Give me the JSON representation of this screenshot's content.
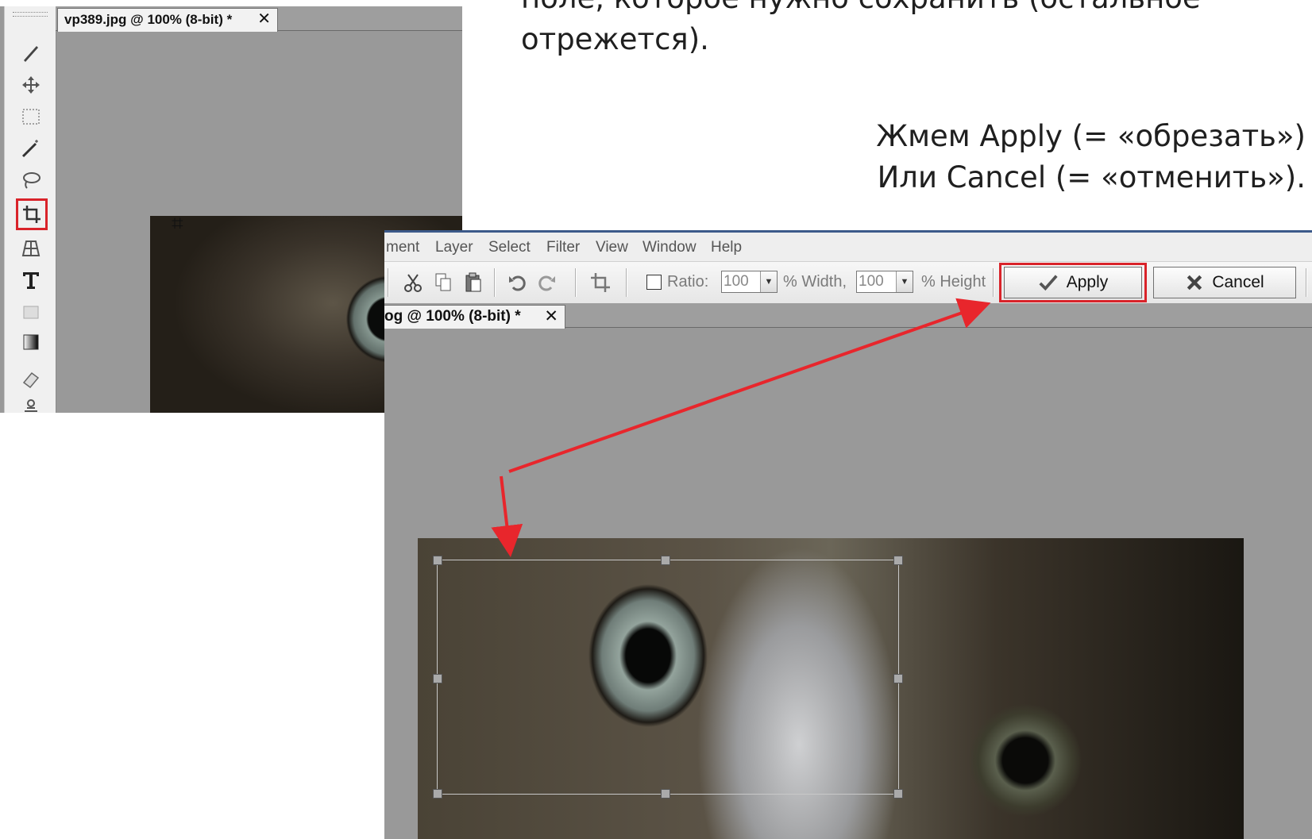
{
  "slide": {
    "top_text": "поле, которое нужно сохранить (остальное отрежется).",
    "instruction_line1": "Жмем Apply (= «обрезать»)",
    "instruction_line2": "Или Cancel (= «отменить»)."
  },
  "screenshot1": {
    "tab_title": "vp389.jpg @ 100% (8-bit) *",
    "tab_close": "✕",
    "tools": [
      "brush-icon",
      "move-icon",
      "marquee-icon",
      "magic-wand-icon",
      "lasso-icon",
      "crop-icon",
      "perspective-icon",
      "text-icon",
      "shape-icon",
      "gradient-icon",
      "eraser-icon",
      "clone-stamp-icon"
    ],
    "cursor": "⌗"
  },
  "screenshot2": {
    "menu": [
      "ment",
      "Layer",
      "Select",
      "Filter",
      "View",
      "Window",
      "Help"
    ],
    "options": {
      "ratio_label": "Ratio:",
      "width_value": "100",
      "width_label": "% Width,",
      "height_value": "100",
      "height_label": "% Height",
      "apply_label": "Apply",
      "cancel_label": "Cancel"
    },
    "tab_title": "og @ 100% (8-bit) *",
    "tab_close": "✕"
  },
  "colors": {
    "highlight": "#d9232a",
    "canvas": "#999999",
    "arrow": "#e8262c"
  }
}
